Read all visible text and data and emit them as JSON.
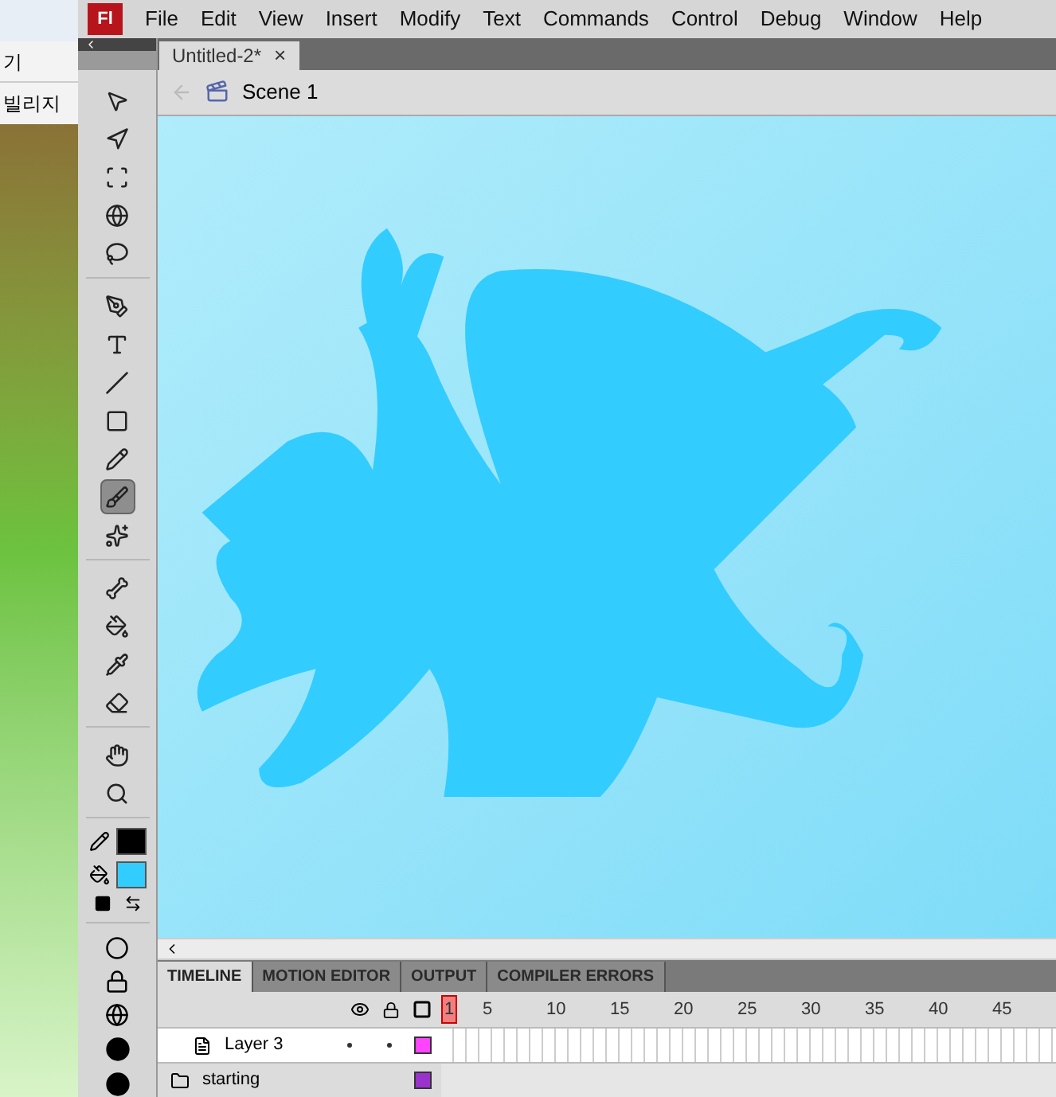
{
  "browser": {
    "toolbar_text": "기",
    "link_text": "빌리지"
  },
  "app": {
    "logo": "Fl",
    "menu": [
      "File",
      "Edit",
      "View",
      "Insert",
      "Modify",
      "Text",
      "Commands",
      "Control",
      "Debug",
      "Window",
      "Help"
    ]
  },
  "document_tab": {
    "title": "Untitled-2*",
    "close": "×"
  },
  "breadcrumb": {
    "scene": "Scene 1"
  },
  "tool_groups": [
    [
      {
        "selected": false
      },
      {
        "selected": false
      },
      {
        "selected": false
      },
      {
        "selected": false
      },
      {
        "selected": false
      }
    ],
    [
      {
        "selected": false
      },
      {
        "selected": false
      },
      {
        "selected": false
      },
      {
        "selected": false
      },
      {
        "selected": false
      },
      {
        "selected": true
      },
      {
        "selected": false
      }
    ],
    [
      {
        "selected": false
      },
      {
        "selected": false
      },
      {
        "selected": false
      },
      {
        "selected": false
      }
    ],
    [
      {
        "selected": false
      },
      {
        "selected": false
      }
    ]
  ],
  "color_swatches": [
    {
      "kind": "stroke",
      "color": "#000000"
    },
    {
      "kind": "fill",
      "color": "#33ccff"
    }
  ],
  "panel_tabs": [
    {
      "label": "TIMELINE",
      "selected": true
    },
    {
      "label": "MOTION EDITOR",
      "selected": false
    },
    {
      "label": "OUTPUT",
      "selected": false
    },
    {
      "label": "COMPILER ERRORS",
      "selected": false
    }
  ],
  "frame_numbers": [
    "1",
    "5",
    "10",
    "15",
    "20",
    "25",
    "30",
    "35",
    "40",
    "45"
  ],
  "layers": [
    {
      "kind": "layer",
      "name": "Layer 3",
      "color": "#ff44ff"
    },
    {
      "kind": "folder",
      "name": "starting",
      "color": "#9933cc"
    }
  ]
}
